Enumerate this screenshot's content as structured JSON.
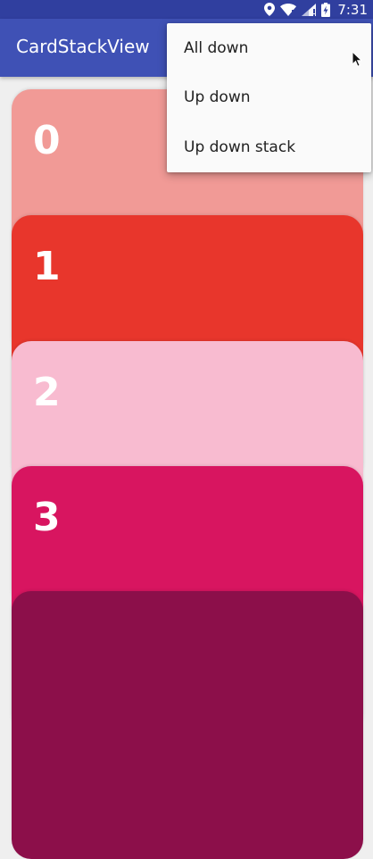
{
  "status_bar": {
    "time": "7:31",
    "icons": [
      "location-icon",
      "wifi-icon",
      "signal-icon",
      "battery-charging-icon"
    ],
    "background": "#303f9f"
  },
  "app_bar": {
    "title": "CardStackView",
    "background": "#3f51b5"
  },
  "cards": [
    {
      "label": "0",
      "color": "#f19a96"
    },
    {
      "label": "1",
      "color": "#e8362c"
    },
    {
      "label": "2",
      "color": "#f8bbd0"
    },
    {
      "label": "3",
      "color": "#d81560"
    },
    {
      "label": "",
      "color": "#8c0f4a"
    }
  ],
  "menu": {
    "items": [
      {
        "label": "All down"
      },
      {
        "label": "Up down"
      },
      {
        "label": "Up down stack"
      }
    ]
  }
}
